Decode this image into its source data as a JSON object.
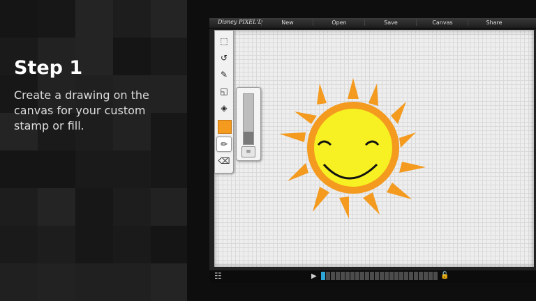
{
  "step": {
    "title": "Step 1",
    "description": "Create a drawing on the canvas for your custom stamp or fill."
  },
  "app": {
    "logo": "Disney PIXEL'D"
  },
  "menu": [
    "New",
    "Open",
    "Save",
    "Canvas",
    "Share"
  ],
  "tools": [
    {
      "name": "select-tool",
      "icon": "marquee-icon",
      "glyph": "⬚"
    },
    {
      "name": "undo-tool",
      "icon": "undo-icon",
      "glyph": "↺"
    },
    {
      "name": "stamp-tool",
      "icon": "stamp-icon",
      "glyph": "✎"
    },
    {
      "name": "shape-tool",
      "icon": "shapes-icon",
      "glyph": "◱"
    },
    {
      "name": "fill-tool",
      "icon": "paint-bucket-icon",
      "glyph": "◈"
    },
    {
      "name": "pencil-tool",
      "icon": "pencil-icon",
      "glyph": "✏"
    },
    {
      "name": "eraser-tool",
      "icon": "eraser-icon",
      "glyph": "⌫"
    }
  ],
  "colors": {
    "current": "#f39a1f",
    "sun_face": "#f7f022",
    "sun_rays": "#f39a1f",
    "sun_features": "#111111",
    "timeline_active": "#2ea6d8"
  },
  "brush_size": {
    "level": 0.25
  },
  "timeline": {
    "frames": 24,
    "active_frame": 1
  }
}
